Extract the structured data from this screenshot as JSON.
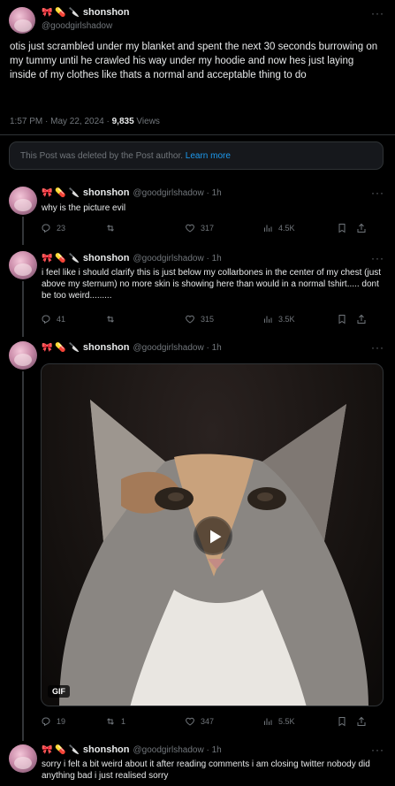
{
  "main_post": {
    "emojis": "🎀 💊 🔪",
    "display_name": "shonshon",
    "handle": "@goodgirlshadow",
    "text": "otis just scrambled under my blanket and spent the next 30 seconds burrowing on my tummy until he crawled his way under my hoodie and now hes just laying inside of my clothes like thats a normal and acceptable thing to do",
    "time": "1:57 PM · May 22, 2024 · ",
    "views_count": "9,835",
    "views_label": " Views"
  },
  "deleted_notice": {
    "text": "This Post was deleted by the Post author. ",
    "link": "Learn more"
  },
  "replies": [
    {
      "emojis": "🎀 💊 🔪",
      "display_name": "shonshon",
      "handle": "@goodgirlshadow · 1h",
      "text": "why is the picture evil",
      "replies": "23",
      "reposts": "",
      "likes": "317",
      "views": "4.5K"
    },
    {
      "emojis": "🎀 💊 🔪",
      "display_name": "shonshon",
      "handle": "@goodgirlshadow · 1h",
      "text": "i feel like i should clarify this is just below my collarbones in the center of my chest (just above my sternum) no more skin is showing here than would in a normal tshirt..... dont be too weird.........",
      "replies": "41",
      "reposts": "",
      "likes": "315",
      "views": "3.5K"
    },
    {
      "emojis": "🎀 💊 🔪",
      "display_name": "shonshon",
      "handle": "@goodgirlshadow · 1h",
      "media_badge": "GIF",
      "replies": "19",
      "reposts": "1",
      "likes": "347",
      "views": "5.5K"
    },
    {
      "emojis": "🎀 💊 🔪",
      "display_name": "shonshon",
      "handle": "@goodgirlshadow · 1h",
      "text": "sorry i felt a bit weird about it after reading comments i am closing twitter nobody did anything bad i just realised sorry"
    }
  ],
  "icons": {
    "more": "···"
  },
  "colors": {
    "background": "#000000",
    "text": "#e7e9ea",
    "muted": "#71767b",
    "link": "#1d9bf0",
    "border": "#2f3336"
  }
}
